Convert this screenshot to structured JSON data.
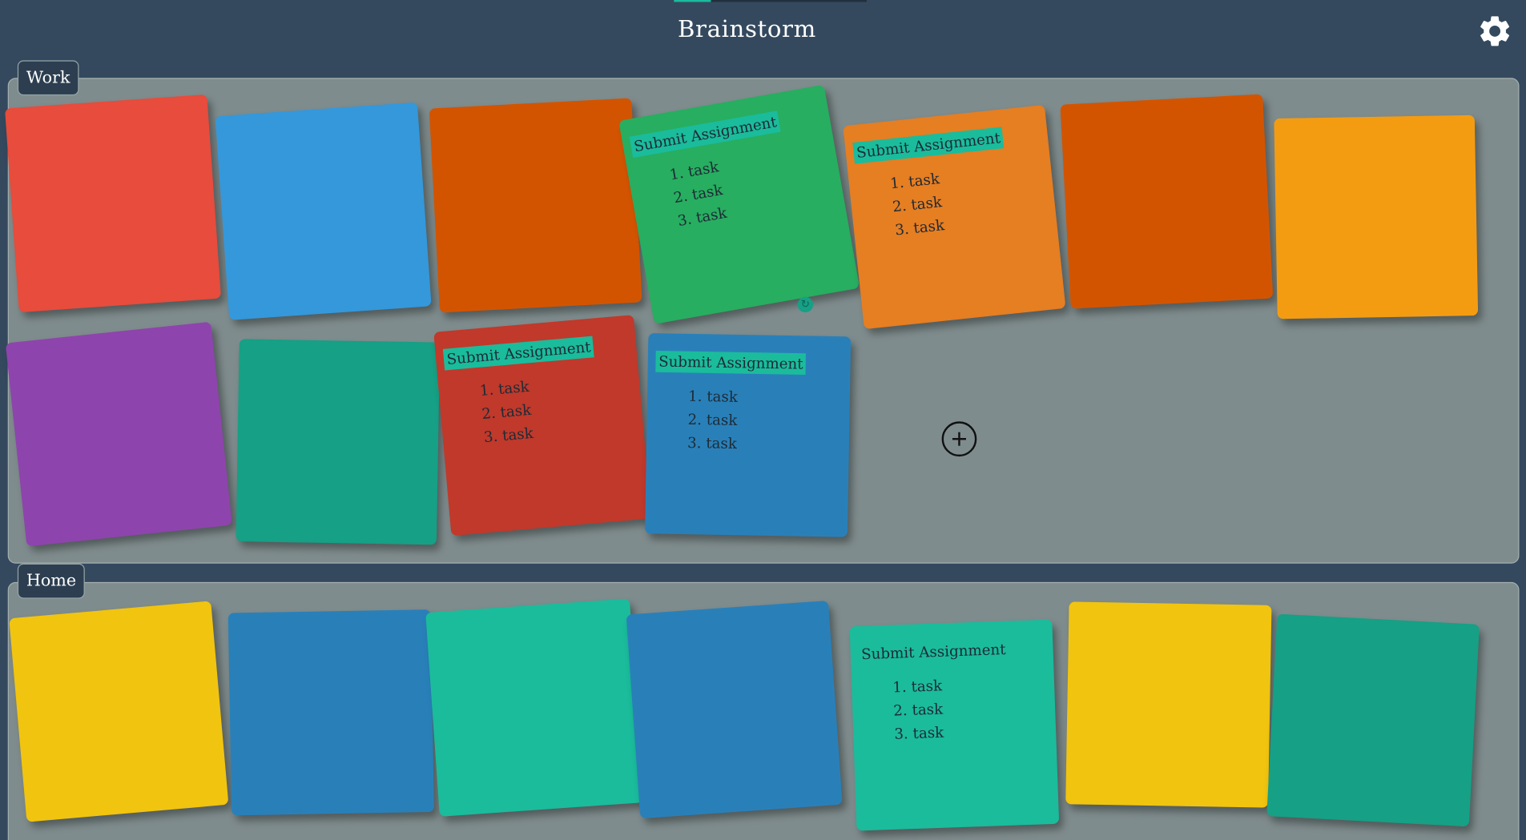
{
  "app": {
    "title": "Brainstorm",
    "settings_icon": "gear-icon"
  },
  "colors": {
    "background": "#34495e",
    "board": "#7f8c8d",
    "tag_bg": "#2c3e50",
    "highlight": "#1abc9c"
  },
  "boards": [
    {
      "label": "Work",
      "notes": [
        {
          "color": "#e74c3c"
        },
        {
          "color": "#3498db"
        },
        {
          "color": "#d35400"
        },
        {
          "color": "#27ae60",
          "title": "Submit Assignment",
          "title_highlight": true,
          "tasks": [
            "task",
            "task",
            "task"
          ]
        },
        {
          "color": "#e67e22",
          "title": "Submit Assignment",
          "title_highlight": true,
          "tasks": [
            "task",
            "task",
            "task"
          ]
        },
        {
          "color": "#d35400"
        },
        {
          "color": "#f39c12"
        },
        {
          "color": "#8e44ad"
        },
        {
          "color": "#16a085"
        },
        {
          "color": "#c0392b",
          "title": "Submit Assignment",
          "title_highlight": true,
          "tasks": [
            "task",
            "task",
            "task"
          ]
        },
        {
          "color": "#2980b9",
          "title": "Submit Assignment",
          "title_highlight": true,
          "tasks": [
            "task",
            "task",
            "task"
          ]
        }
      ],
      "add_icon": "plus-circle-icon"
    },
    {
      "label": "Home",
      "notes": [
        {
          "color": "#f1c40f"
        },
        {
          "color": "#2980b9"
        },
        {
          "color": "#1abc9c"
        },
        {
          "color": "#2980b9"
        },
        {
          "color": "#1abc9c",
          "title": "Submit Assignment",
          "title_highlight": false,
          "tasks": [
            "task",
            "task",
            "task"
          ]
        },
        {
          "color": "#f1c40f"
        },
        {
          "color": "#16a085"
        }
      ]
    }
  ]
}
